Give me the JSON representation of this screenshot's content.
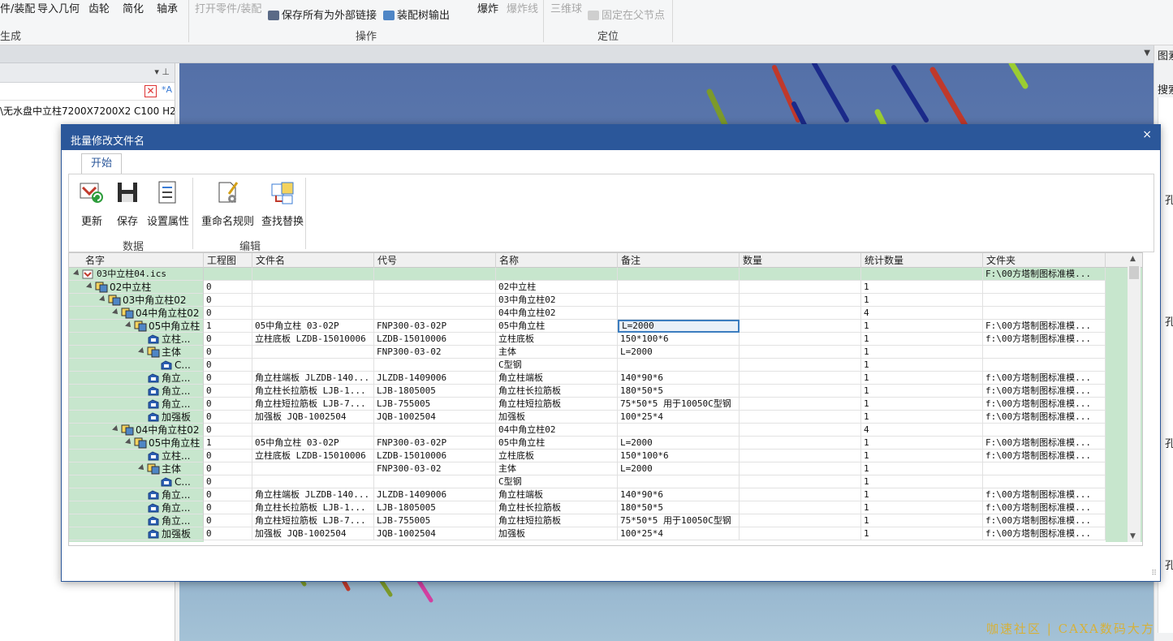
{
  "ribbon": {
    "items": [
      {
        "label": "件/装配",
        "dim": false
      },
      {
        "label": "导入几何",
        "dim": false
      },
      {
        "label": "齿轮",
        "dim": false
      },
      {
        "label": "简化",
        "dim": false
      },
      {
        "label": "轴承",
        "dim": false
      },
      {
        "label": "打开零件/装配",
        "dim": true
      },
      {
        "label": "保存所有为外部链接",
        "dim": false
      },
      {
        "label": "装配树输出",
        "dim": false
      },
      {
        "label": "爆炸",
        "dim": false
      },
      {
        "label": "爆炸线",
        "dim": true
      },
      {
        "label": "三维球",
        "dim": true
      },
      {
        "label": "固定在父节点",
        "dim": true
      }
    ],
    "groups": [
      "生成",
      "操作",
      "定位"
    ]
  },
  "left_panel": {
    "row_text": "\\无水盘中立柱7200X7200X2 C100  H20"
  },
  "right_panel": {
    "texts": [
      "图素",
      "搜索",
      "孔",
      "孔",
      "孔",
      "孔"
    ]
  },
  "watermark": "咖速社区 | CAXA数码大方",
  "dialog": {
    "title": "批量修改文件名",
    "close": "×",
    "tab": "开始",
    "tools": [
      {
        "label": "更新",
        "icon": "refresh-icon"
      },
      {
        "label": "保存",
        "icon": "save-icon"
      },
      {
        "label": "设置属性",
        "icon": "properties-icon"
      },
      {
        "label": "重命名规则",
        "icon": "rename-rule-icon"
      },
      {
        "label": "查找替换",
        "icon": "find-replace-icon"
      }
    ],
    "groups": [
      "数据",
      "编辑"
    ]
  },
  "grid": {
    "columns": [
      "名字",
      "工程图",
      "文件名",
      "代号",
      "名称",
      "备注",
      "数量",
      "统计数量",
      "文件夹"
    ],
    "rows": [
      {
        "level": 0,
        "expand": true,
        "icon": "assembly-root",
        "name": "03中立柱04.ics",
        "mono": true,
        "drawing": "",
        "filename": "",
        "code": "",
        "title": "",
        "note": "",
        "qty": "",
        "total": "",
        "folder": "F:\\00方塔制图标准模..."
      },
      {
        "level": 1,
        "expand": true,
        "icon": "assembly",
        "name": "02中立柱",
        "drawing": "0",
        "filename": "",
        "code": "",
        "title": "02中立柱",
        "note": "",
        "qty": "",
        "total": "1",
        "folder": ""
      },
      {
        "level": 2,
        "expand": true,
        "icon": "assembly",
        "name": "03中角立柱02",
        "drawing": "0",
        "filename": "",
        "code": "",
        "title": "03中角立柱02",
        "note": "",
        "qty": "",
        "total": "1",
        "folder": ""
      },
      {
        "level": 3,
        "expand": true,
        "icon": "assembly",
        "name": "04中角立柱02",
        "drawing": "0",
        "filename": "",
        "code": "",
        "title": "04中角立柱02",
        "note": "",
        "qty": "",
        "total": "4",
        "folder": ""
      },
      {
        "level": 4,
        "expand": true,
        "icon": "assembly",
        "name": "05中角立柱",
        "drawing": "1",
        "filename": "05中角立柱 03-02P",
        "code": "FNP300-03-02P",
        "title": "05中角立柱",
        "note": "L=2000",
        "editing": true,
        "qty": "",
        "total": "1",
        "folder": "F:\\00方塔制图标准模..."
      },
      {
        "level": 5,
        "expand": false,
        "icon": "part",
        "name": "立柱...",
        "drawing": "0",
        "filename": "立柱底板 LZDB-15010006",
        "code": "LZDB-15010006",
        "title": "立柱底板",
        "note": "150*100*6",
        "qty": "",
        "total": "1",
        "folder": "f:\\00方塔制图标准模..."
      },
      {
        "level": 5,
        "expand": true,
        "icon": "assembly",
        "name": "主体",
        "drawing": "0",
        "filename": "",
        "code": "FNP300-03-02",
        "title": "主体",
        "note": "L=2000",
        "qty": "",
        "total": "1",
        "folder": ""
      },
      {
        "level": 6,
        "expand": false,
        "icon": "part",
        "name": "C...",
        "drawing": "0",
        "filename": "",
        "code": "",
        "title": "C型钢",
        "note": "",
        "qty": "",
        "total": "1",
        "folder": ""
      },
      {
        "level": 5,
        "expand": false,
        "icon": "part",
        "name": "角立...",
        "drawing": "0",
        "filename": "角立柱端板 JLZDB-140...",
        "code": "JLZDB-1409006",
        "title": "角立柱端板",
        "note": "140*90*6",
        "qty": "",
        "total": "1",
        "folder": "f:\\00方塔制图标准模..."
      },
      {
        "level": 5,
        "expand": false,
        "icon": "part",
        "name": "角立...",
        "drawing": "0",
        "filename": "角立柱长拉筋板 LJB-1...",
        "code": "LJB-1805005",
        "title": "角立柱长拉筋板",
        "note": "180*50*5",
        "qty": "",
        "total": "1",
        "folder": "f:\\00方塔制图标准模..."
      },
      {
        "level": 5,
        "expand": false,
        "icon": "part",
        "name": "角立...",
        "drawing": "0",
        "filename": "角立柱短拉筋板 LJB-7...",
        "code": "LJB-755005",
        "title": "角立柱短拉筋板",
        "note": "75*50*5 用于10050C型钢",
        "qty": "",
        "total": "1",
        "folder": "f:\\00方塔制图标准模..."
      },
      {
        "level": 5,
        "expand": false,
        "icon": "part",
        "name": "加强板",
        "drawing": "0",
        "filename": "加强板 JQB-1002504",
        "code": "JQB-1002504",
        "title": "加强板",
        "note": "100*25*4",
        "qty": "",
        "total": "1",
        "folder": "f:\\00方塔制图标准模..."
      },
      {
        "level": 3,
        "expand": true,
        "icon": "assembly",
        "name": "04中角立柱02",
        "drawing": "0",
        "filename": "",
        "code": "",
        "title": "04中角立柱02",
        "note": "",
        "qty": "",
        "total": "4",
        "folder": ""
      },
      {
        "level": 4,
        "expand": true,
        "icon": "assembly",
        "name": "05中角立柱",
        "drawing": "1",
        "filename": "05中角立柱 03-02P",
        "code": "FNP300-03-02P",
        "title": "05中角立柱",
        "note": "L=2000",
        "qty": "",
        "total": "1",
        "folder": "F:\\00方塔制图标准模..."
      },
      {
        "level": 5,
        "expand": false,
        "icon": "part",
        "name": "立柱...",
        "drawing": "0",
        "filename": "立柱底板 LZDB-15010006",
        "code": "LZDB-15010006",
        "title": "立柱底板",
        "note": "150*100*6",
        "qty": "",
        "total": "1",
        "folder": "f:\\00方塔制图标准模..."
      },
      {
        "level": 5,
        "expand": true,
        "icon": "assembly",
        "name": "主体",
        "drawing": "0",
        "filename": "",
        "code": "FNP300-03-02",
        "title": "主体",
        "note": "L=2000",
        "qty": "",
        "total": "1",
        "folder": ""
      },
      {
        "level": 6,
        "expand": false,
        "icon": "part",
        "name": "C...",
        "drawing": "0",
        "filename": "",
        "code": "",
        "title": "C型钢",
        "note": "",
        "qty": "",
        "total": "1",
        "folder": ""
      },
      {
        "level": 5,
        "expand": false,
        "icon": "part",
        "name": "角立...",
        "drawing": "0",
        "filename": "角立柱端板 JLZDB-140...",
        "code": "JLZDB-1409006",
        "title": "角立柱端板",
        "note": "140*90*6",
        "qty": "",
        "total": "1",
        "folder": "f:\\00方塔制图标准模..."
      },
      {
        "level": 5,
        "expand": false,
        "icon": "part",
        "name": "角立...",
        "drawing": "0",
        "filename": "角立柱长拉筋板 LJB-1...",
        "code": "LJB-1805005",
        "title": "角立柱长拉筋板",
        "note": "180*50*5",
        "qty": "",
        "total": "1",
        "folder": "f:\\00方塔制图标准模..."
      },
      {
        "level": 5,
        "expand": false,
        "icon": "part",
        "name": "角立...",
        "drawing": "0",
        "filename": "角立柱短拉筋板 LJB-7...",
        "code": "LJB-755005",
        "title": "角立柱短拉筋板",
        "note": "75*50*5 用于10050C型钢",
        "qty": "",
        "total": "1",
        "folder": "f:\\00方塔制图标准模..."
      },
      {
        "level": 5,
        "expand": false,
        "icon": "part",
        "name": "加强板",
        "drawing": "0",
        "filename": "加强板 JQB-1002504",
        "code": "JQB-1002504",
        "title": "加强板",
        "note": "100*25*4",
        "qty": "",
        "total": "1",
        "folder": "f:\\00方塔制图标准模..."
      }
    ]
  }
}
